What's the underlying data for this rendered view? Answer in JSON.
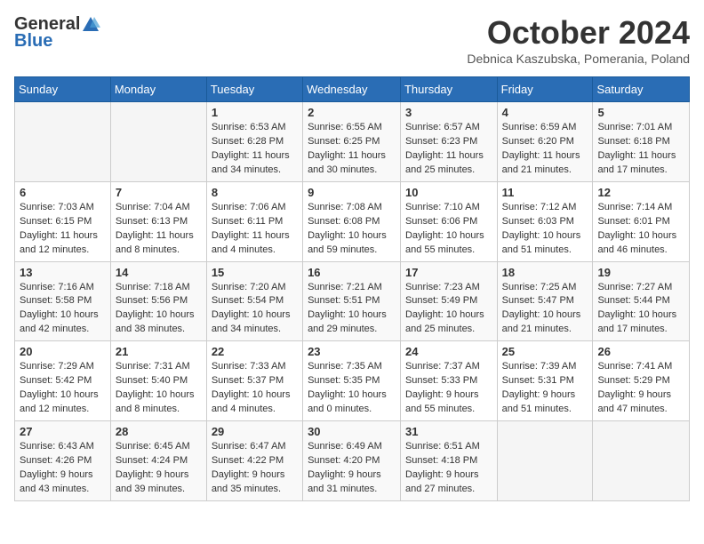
{
  "logo": {
    "general": "General",
    "blue": "Blue"
  },
  "title": "October 2024",
  "location": "Debnica Kaszubska, Pomerania, Poland",
  "weekdays": [
    "Sunday",
    "Monday",
    "Tuesday",
    "Wednesday",
    "Thursday",
    "Friday",
    "Saturday"
  ],
  "weeks": [
    [
      {
        "day": "",
        "info": ""
      },
      {
        "day": "",
        "info": ""
      },
      {
        "day": "1",
        "info": "Sunrise: 6:53 AM\nSunset: 6:28 PM\nDaylight: 11 hours\nand 34 minutes."
      },
      {
        "day": "2",
        "info": "Sunrise: 6:55 AM\nSunset: 6:25 PM\nDaylight: 11 hours\nand 30 minutes."
      },
      {
        "day": "3",
        "info": "Sunrise: 6:57 AM\nSunset: 6:23 PM\nDaylight: 11 hours\nand 25 minutes."
      },
      {
        "day": "4",
        "info": "Sunrise: 6:59 AM\nSunset: 6:20 PM\nDaylight: 11 hours\nand 21 minutes."
      },
      {
        "day": "5",
        "info": "Sunrise: 7:01 AM\nSunset: 6:18 PM\nDaylight: 11 hours\nand 17 minutes."
      }
    ],
    [
      {
        "day": "6",
        "info": "Sunrise: 7:03 AM\nSunset: 6:15 PM\nDaylight: 11 hours\nand 12 minutes."
      },
      {
        "day": "7",
        "info": "Sunrise: 7:04 AM\nSunset: 6:13 PM\nDaylight: 11 hours\nand 8 minutes."
      },
      {
        "day": "8",
        "info": "Sunrise: 7:06 AM\nSunset: 6:11 PM\nDaylight: 11 hours\nand 4 minutes."
      },
      {
        "day": "9",
        "info": "Sunrise: 7:08 AM\nSunset: 6:08 PM\nDaylight: 10 hours\nand 59 minutes."
      },
      {
        "day": "10",
        "info": "Sunrise: 7:10 AM\nSunset: 6:06 PM\nDaylight: 10 hours\nand 55 minutes."
      },
      {
        "day": "11",
        "info": "Sunrise: 7:12 AM\nSunset: 6:03 PM\nDaylight: 10 hours\nand 51 minutes."
      },
      {
        "day": "12",
        "info": "Sunrise: 7:14 AM\nSunset: 6:01 PM\nDaylight: 10 hours\nand 46 minutes."
      }
    ],
    [
      {
        "day": "13",
        "info": "Sunrise: 7:16 AM\nSunset: 5:58 PM\nDaylight: 10 hours\nand 42 minutes."
      },
      {
        "day": "14",
        "info": "Sunrise: 7:18 AM\nSunset: 5:56 PM\nDaylight: 10 hours\nand 38 minutes."
      },
      {
        "day": "15",
        "info": "Sunrise: 7:20 AM\nSunset: 5:54 PM\nDaylight: 10 hours\nand 34 minutes."
      },
      {
        "day": "16",
        "info": "Sunrise: 7:21 AM\nSunset: 5:51 PM\nDaylight: 10 hours\nand 29 minutes."
      },
      {
        "day": "17",
        "info": "Sunrise: 7:23 AM\nSunset: 5:49 PM\nDaylight: 10 hours\nand 25 minutes."
      },
      {
        "day": "18",
        "info": "Sunrise: 7:25 AM\nSunset: 5:47 PM\nDaylight: 10 hours\nand 21 minutes."
      },
      {
        "day": "19",
        "info": "Sunrise: 7:27 AM\nSunset: 5:44 PM\nDaylight: 10 hours\nand 17 minutes."
      }
    ],
    [
      {
        "day": "20",
        "info": "Sunrise: 7:29 AM\nSunset: 5:42 PM\nDaylight: 10 hours\nand 12 minutes."
      },
      {
        "day": "21",
        "info": "Sunrise: 7:31 AM\nSunset: 5:40 PM\nDaylight: 10 hours\nand 8 minutes."
      },
      {
        "day": "22",
        "info": "Sunrise: 7:33 AM\nSunset: 5:37 PM\nDaylight: 10 hours\nand 4 minutes."
      },
      {
        "day": "23",
        "info": "Sunrise: 7:35 AM\nSunset: 5:35 PM\nDaylight: 10 hours\nand 0 minutes."
      },
      {
        "day": "24",
        "info": "Sunrise: 7:37 AM\nSunset: 5:33 PM\nDaylight: 9 hours\nand 55 minutes."
      },
      {
        "day": "25",
        "info": "Sunrise: 7:39 AM\nSunset: 5:31 PM\nDaylight: 9 hours\nand 51 minutes."
      },
      {
        "day": "26",
        "info": "Sunrise: 7:41 AM\nSunset: 5:29 PM\nDaylight: 9 hours\nand 47 minutes."
      }
    ],
    [
      {
        "day": "27",
        "info": "Sunrise: 6:43 AM\nSunset: 4:26 PM\nDaylight: 9 hours\nand 43 minutes."
      },
      {
        "day": "28",
        "info": "Sunrise: 6:45 AM\nSunset: 4:24 PM\nDaylight: 9 hours\nand 39 minutes."
      },
      {
        "day": "29",
        "info": "Sunrise: 6:47 AM\nSunset: 4:22 PM\nDaylight: 9 hours\nand 35 minutes."
      },
      {
        "day": "30",
        "info": "Sunrise: 6:49 AM\nSunset: 4:20 PM\nDaylight: 9 hours\nand 31 minutes."
      },
      {
        "day": "31",
        "info": "Sunrise: 6:51 AM\nSunset: 4:18 PM\nDaylight: 9 hours\nand 27 minutes."
      },
      {
        "day": "",
        "info": ""
      },
      {
        "day": "",
        "info": ""
      }
    ]
  ]
}
